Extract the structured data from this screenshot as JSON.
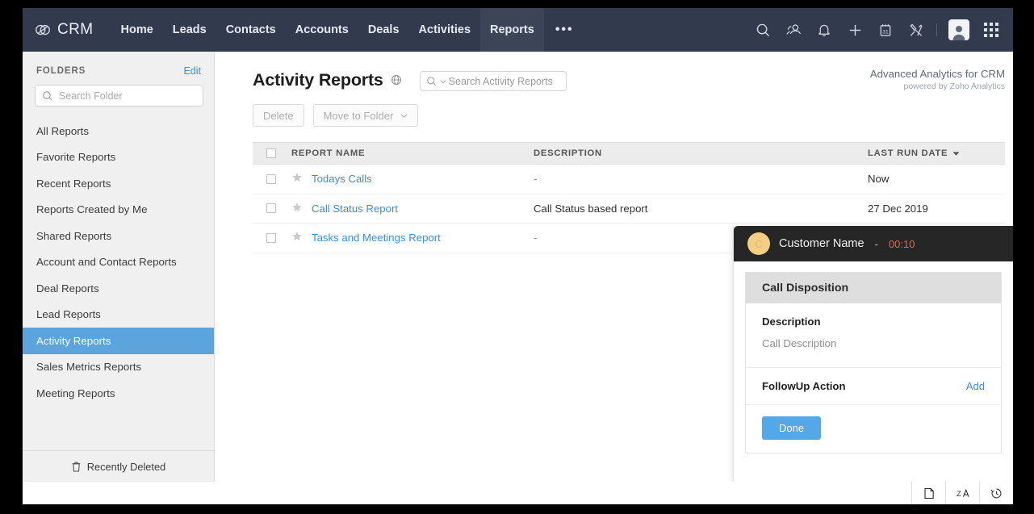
{
  "topnav": {
    "brand": "CRM",
    "items": [
      {
        "label": "Home",
        "active": false
      },
      {
        "label": "Leads",
        "active": false
      },
      {
        "label": "Contacts",
        "active": false
      },
      {
        "label": "Accounts",
        "active": false
      },
      {
        "label": "Deals",
        "active": false
      },
      {
        "label": "Activities",
        "active": false
      },
      {
        "label": "Reports",
        "active": true
      }
    ],
    "more": "•••",
    "icons": [
      "search-icon",
      "contacts-icon",
      "bell-icon",
      "plus-icon",
      "calendar-icon",
      "tools-icon",
      "avatar",
      "apps-grid-icon"
    ],
    "calendar_day": "31"
  },
  "sidebar": {
    "heading": "FOLDERS",
    "edit_label": "Edit",
    "search_placeholder": "Search Folder",
    "items": [
      {
        "label": "All Reports",
        "active": false
      },
      {
        "label": "Favorite Reports",
        "active": false
      },
      {
        "label": "Recent Reports",
        "active": false
      },
      {
        "label": "Reports Created by Me",
        "active": false
      },
      {
        "label": "Shared Reports",
        "active": false
      },
      {
        "label": "Account and Contact Reports",
        "active": false
      },
      {
        "label": "Deal Reports",
        "active": false
      },
      {
        "label": "Lead Reports",
        "active": false
      },
      {
        "label": "Activity Reports",
        "active": true
      },
      {
        "label": "Sales Metrics Reports",
        "active": false
      },
      {
        "label": "Meeting Reports",
        "active": false
      }
    ],
    "recently_deleted": "Recently Deleted"
  },
  "main": {
    "title": "Activity Reports",
    "search_placeholder": "Search Activity Reports",
    "branding": {
      "title": "Advanced Analytics for CRM",
      "subtitle": "powered by Zoho Analytics"
    },
    "toolbar": {
      "delete_label": "Delete",
      "move_label": "Move to Folder"
    },
    "table": {
      "columns": [
        "REPORT NAME",
        "DESCRIPTION",
        "LAST RUN DATE"
      ],
      "sort_column": "LAST RUN DATE",
      "rows": [
        {
          "name": "Todays Calls",
          "description": "-",
          "last_run": "Now"
        },
        {
          "name": "Call Status Report",
          "description": "Call Status based report",
          "last_run": "27 Dec 2019"
        },
        {
          "name": "Tasks and Meetings Report",
          "description": "-",
          "last_run": ""
        }
      ]
    }
  },
  "call_popup": {
    "avatar_initial": "C",
    "customer_name": "Customer Name",
    "separator": "-",
    "timer": "00:10",
    "card_title": "Call Disposition",
    "description_label": "Description",
    "description_value": "Call Description",
    "followup_label": "FollowUp Action",
    "add_label": "Add",
    "done_label": "Done"
  },
  "taskbar": {
    "icons": [
      "notes-icon",
      "translate-icon",
      "history-icon"
    ]
  },
  "colors": {
    "nav_bg": "#323a4d",
    "nav_active": "#3c4558",
    "sidebar_bg": "#f0f0f0",
    "sidebar_active": "#5ba4dd",
    "link": "#3c8ddc",
    "accent_button": "#55a8e8",
    "timer": "#e06a4e",
    "popup_header": "#262626",
    "avatar_gold": "#f3cf84"
  }
}
